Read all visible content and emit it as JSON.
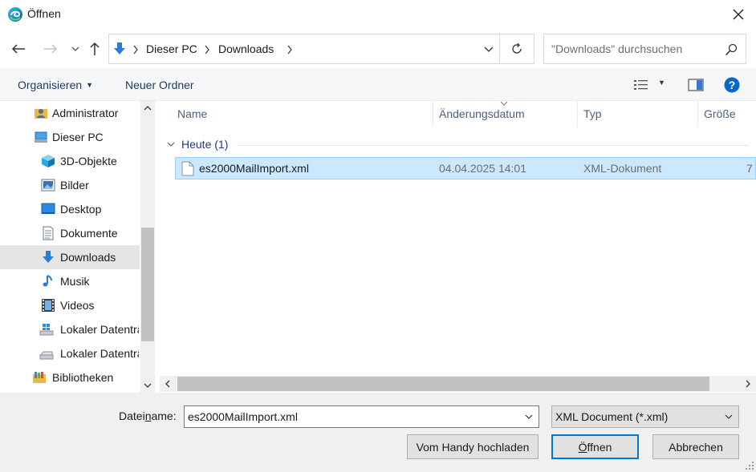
{
  "window": {
    "title": "Öffnen"
  },
  "nav": {
    "breadcrumbs": [
      "Dieser PC",
      "Downloads"
    ],
    "search_placeholder": "\"Downloads\" durchsuchen"
  },
  "toolbar": {
    "organize_label": "Organisieren",
    "new_folder_label": "Neuer Ordner"
  },
  "sidebar": {
    "items": [
      {
        "label": "Administrator",
        "icon": "user-folder-icon"
      },
      {
        "label": "Dieser PC",
        "icon": "computer-icon"
      },
      {
        "label": "3D-Objekte",
        "icon": "cube-icon"
      },
      {
        "label": "Bilder",
        "icon": "pictures-icon"
      },
      {
        "label": "Desktop",
        "icon": "desktop-icon"
      },
      {
        "label": "Dokumente",
        "icon": "document-icon"
      },
      {
        "label": "Downloads",
        "icon": "download-icon"
      },
      {
        "label": "Musik",
        "icon": "music-icon"
      },
      {
        "label": "Videos",
        "icon": "video-icon"
      },
      {
        "label": "Lokaler Datenträger (C:)",
        "icon": "windows-drive-icon"
      },
      {
        "label": "Lokaler Datenträger (D:)",
        "icon": "drive-icon"
      },
      {
        "label": "Bibliotheken",
        "icon": "library-icon"
      }
    ],
    "selected": "Downloads"
  },
  "columns": {
    "name": "Name",
    "date": "Änderungsdatum",
    "type": "Typ",
    "size": "Größe"
  },
  "group": {
    "label": "Heute (1)"
  },
  "files": [
    {
      "name": "es2000MailImport.xml",
      "date": "04.04.2025 14:01",
      "type": "XML-Dokument",
      "size": "7"
    }
  ],
  "footer": {
    "filename_label_pre": "Datei",
    "filename_label_u": "n",
    "filename_label_post": "ame:",
    "filename_value": "es2000MailImport.xml",
    "filetype_value": "XML Document (*.xml)",
    "upload_label": "Vom Handy hochladen",
    "open_label_u": "Ö",
    "open_label_rest": "ffnen",
    "cancel_label": "Abbrechen"
  },
  "colors": {
    "selection_bg": "#cce8ff",
    "selection_border": "#99d1ff",
    "accent": "#0078d7",
    "footer_bg": "#f0f0f0"
  }
}
